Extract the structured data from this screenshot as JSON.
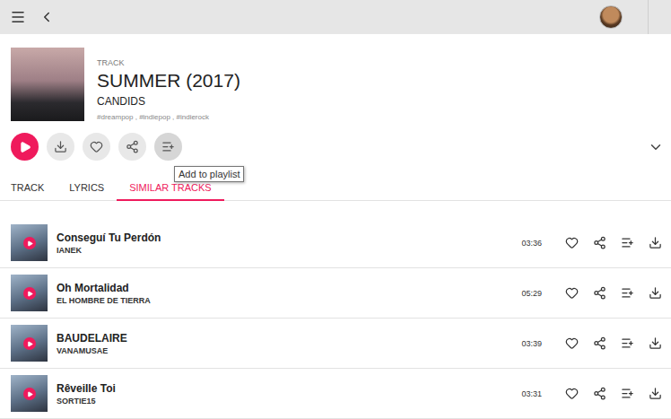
{
  "track": {
    "type": "TRACK",
    "title": "SUMMER (2017)",
    "artist": "CANDIDS",
    "tags": "#dreampop , #indiepop , #indierock"
  },
  "actions": [
    {
      "name": "play",
      "highlighted": false
    },
    {
      "name": "download",
      "highlighted": false
    },
    {
      "name": "like",
      "highlighted": false
    },
    {
      "name": "share",
      "highlighted": false
    },
    {
      "name": "add-to-playlist",
      "highlighted": true
    }
  ],
  "tooltip": {
    "text": "Add to playlist"
  },
  "tabs": [
    {
      "label": "TRACK",
      "selected": false
    },
    {
      "label": "LYRICS",
      "selected": false
    },
    {
      "label": "SIMILAR TRACKS",
      "selected": true
    }
  ],
  "similar_tracks": [
    {
      "title": "Conseguí Tu Perdón",
      "artist": "IANEK",
      "duration": "03:36"
    },
    {
      "title": "Oh Mortalidad",
      "artist": "EL HOMBRE DE TIERRA",
      "duration": "05:29"
    },
    {
      "title": "BAUDELAIRE",
      "artist": "VANAMUSAE",
      "duration": "03:39"
    },
    {
      "title": "Rêveille Toi",
      "artist": "SORTIE15",
      "duration": "03:31"
    }
  ]
}
